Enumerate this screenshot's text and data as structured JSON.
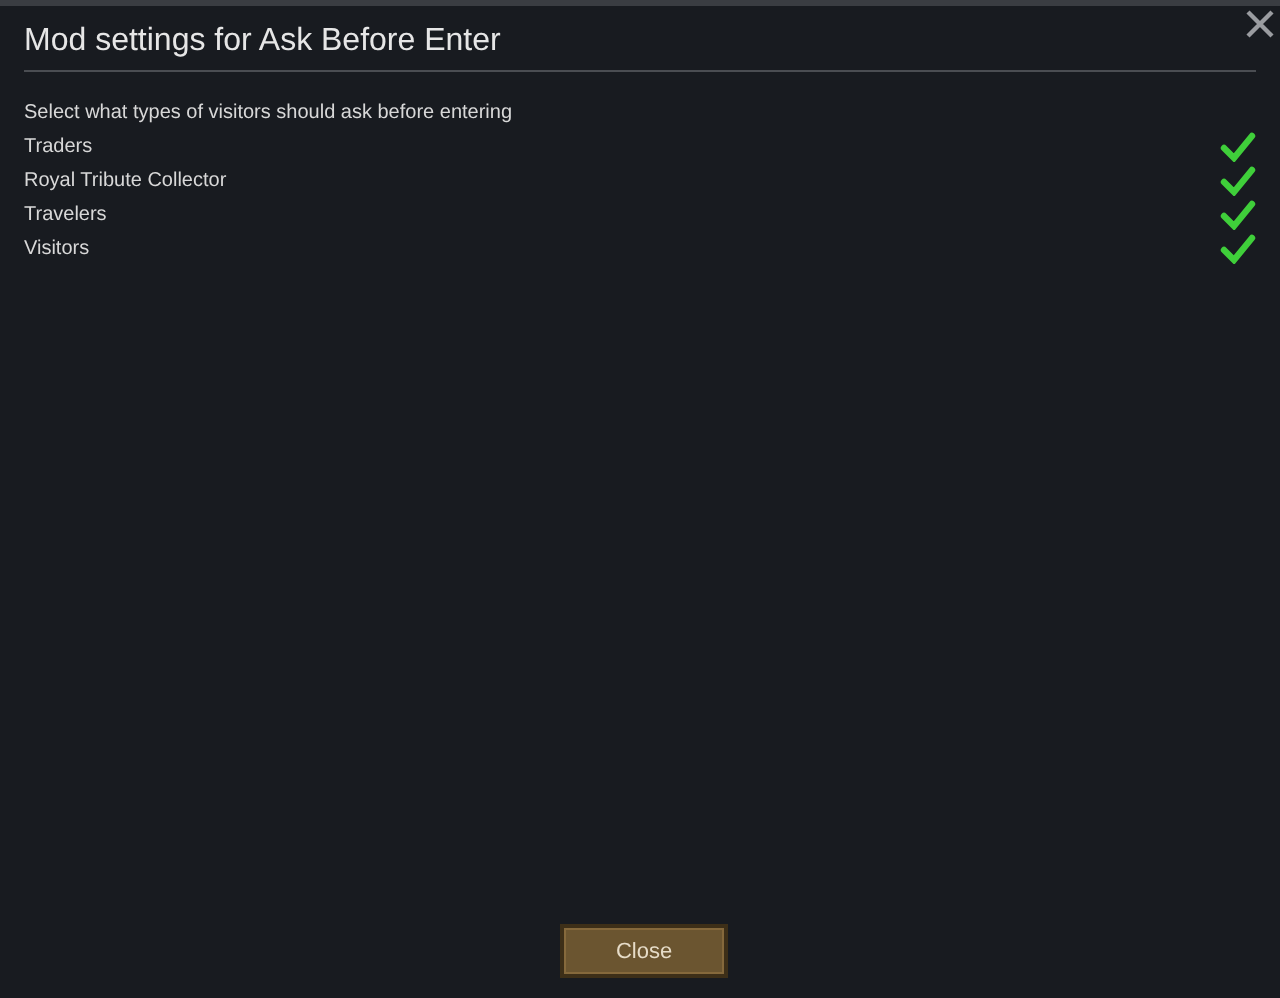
{
  "window": {
    "title": "Mod settings for Ask Before Enter"
  },
  "description": "Select what types of visitors should ask before entering",
  "options": [
    {
      "label": "Traders",
      "checked": true
    },
    {
      "label": "Royal Tribute Collector",
      "checked": true
    },
    {
      "label": "Travelers",
      "checked": true
    },
    {
      "label": "Visitors",
      "checked": true
    }
  ],
  "buttons": [
    "Close"
  ]
}
